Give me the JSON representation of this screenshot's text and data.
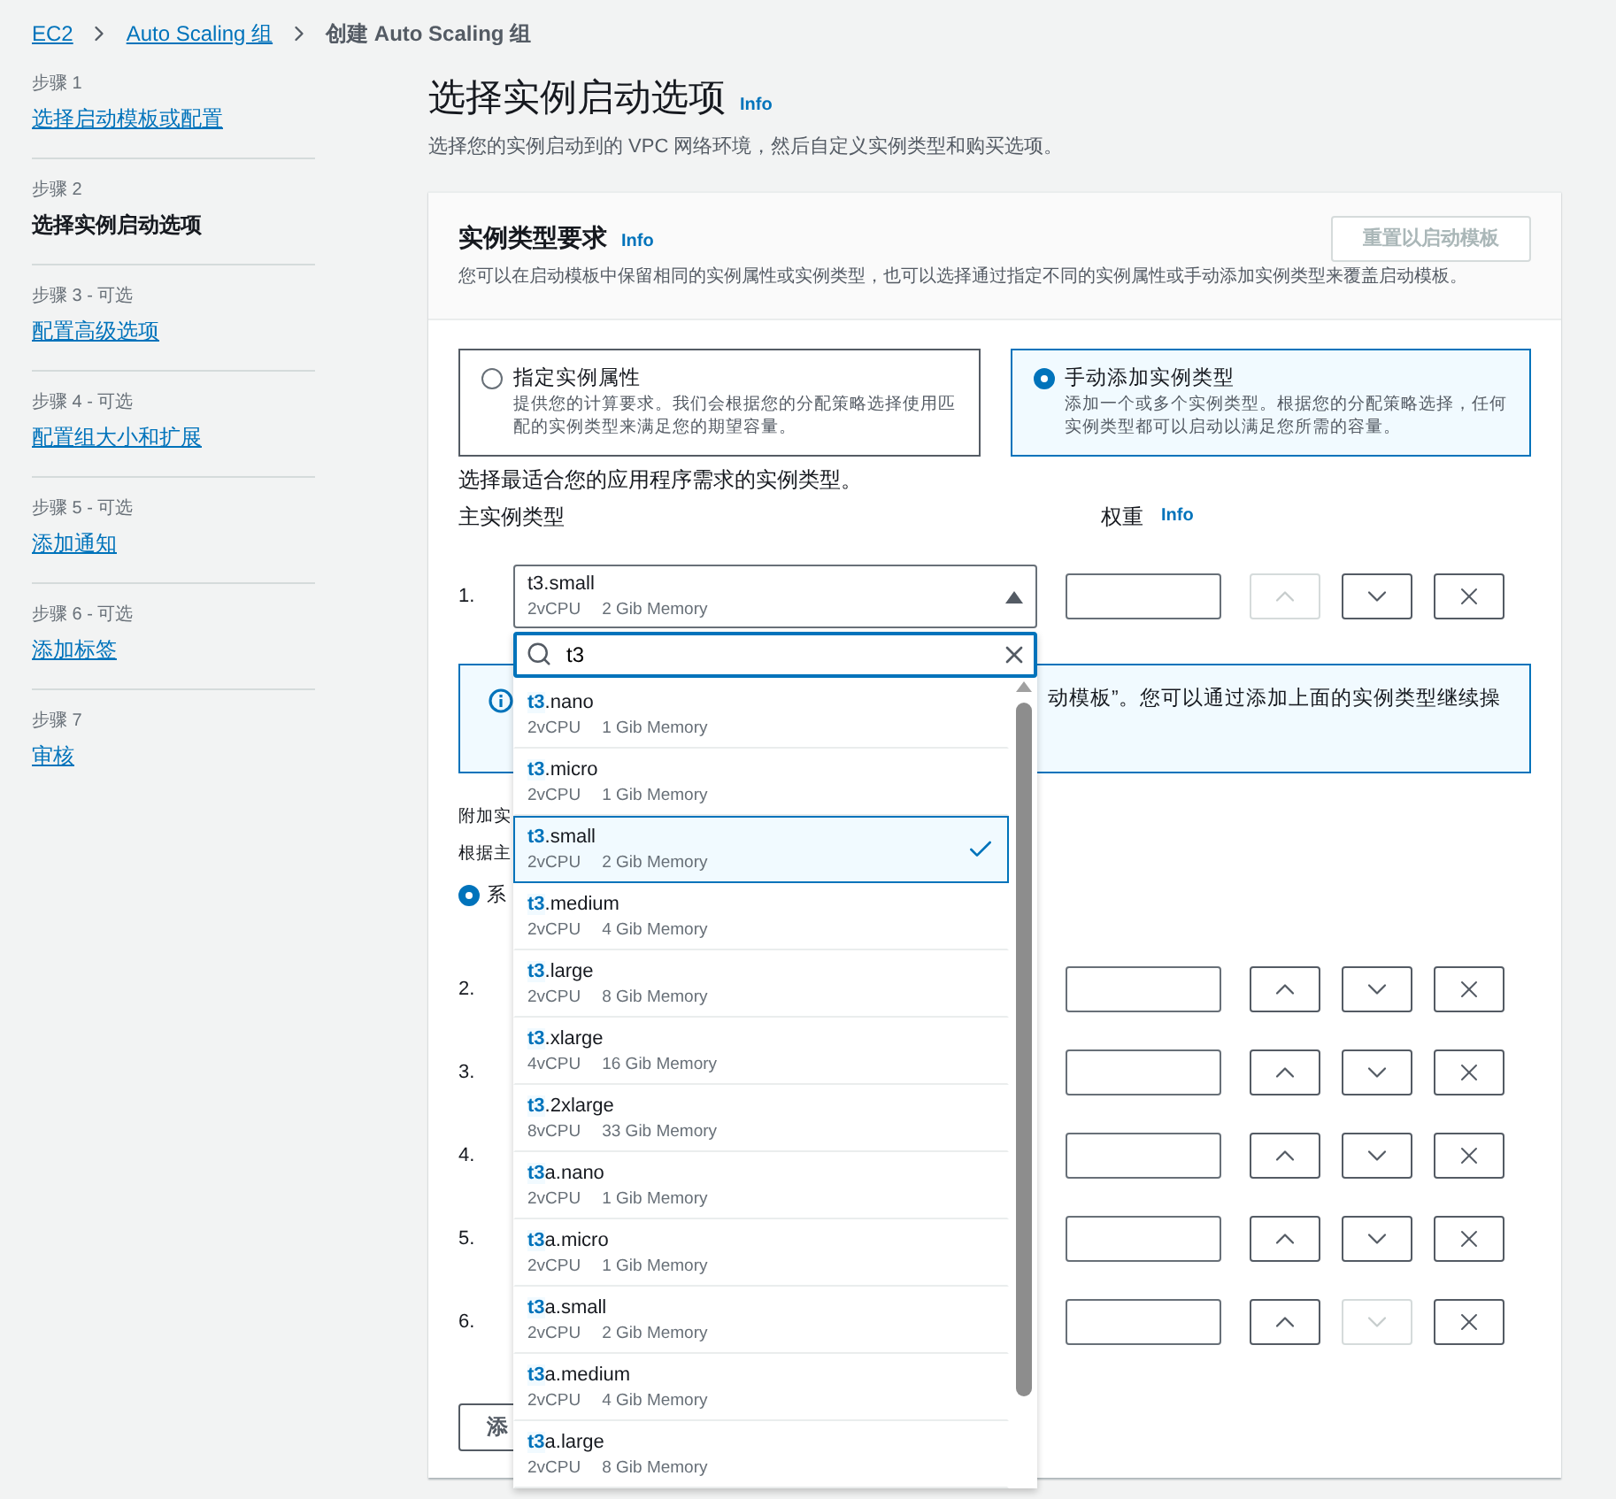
{
  "breadcrumb": [
    {
      "label": "EC2",
      "kind": "link"
    },
    {
      "label": "Auto Scaling 组",
      "kind": "link"
    },
    {
      "label": "创建 Auto Scaling 组",
      "kind": "current"
    }
  ],
  "steps": [
    {
      "label": "步骤 1",
      "title": "选择启动模板或配置",
      "selected": false
    },
    {
      "label": "步骤 2",
      "title": "选择实例启动选项",
      "selected": true
    },
    {
      "label": "步骤 3 - 可选",
      "title": "配置高级选项",
      "selected": false
    },
    {
      "label": "步骤 4 - 可选",
      "title": "配置组大小和扩展",
      "selected": false
    },
    {
      "label": "步骤 5 - 可选",
      "title": "添加通知",
      "selected": false
    },
    {
      "label": "步骤 6 - 可选",
      "title": "添加标签",
      "selected": false
    },
    {
      "label": "步骤 7",
      "title": "审核",
      "selected": false
    }
  ],
  "page": {
    "title": "选择实例启动选项",
    "info": "Info",
    "subtitle": "选择您的实例启动到的 VPC 网络环境，然后自定义实例类型和购买选项。"
  },
  "panel": {
    "title": "实例类型要求",
    "info": "Info",
    "description": "您可以在启动模板中保留相同的实例属性或实例类型，也可以选择通过指定不同的实例属性或手动添加实例类型来覆盖启动模板。",
    "reset_button": {
      "label": "重置以启动模板",
      "disabled": true
    }
  },
  "options": [
    {
      "title": "指定实例属性",
      "description": "提供您的计算要求。我们会根据您的分配策略选择使用匹配的实例类型来满足您的期望容量。",
      "selected": false
    },
    {
      "title": "手动添加实例类型",
      "description": "添加一个或多个实例类型。根据您的分配策略选择，任何实例类型都可以启动以满足您所需的容量。",
      "selected": true
    }
  ],
  "hint": "选择最适合您的应用程序需求的实例类型。",
  "primary_label": "主实例类型",
  "weight_label": "权重",
  "weight_info": "Info",
  "primary_select": {
    "value": "t3.small",
    "cpu": "2vCPU",
    "memory": "2 Gib Memory",
    "expanded": true
  },
  "dropdown": {
    "search": "t3",
    "items": [
      {
        "match": "t3",
        "rest": ".nano",
        "cpu": "2vCPU",
        "memory": "1 Gib Memory",
        "selected": false
      },
      {
        "match": "t3",
        "rest": ".micro",
        "cpu": "2vCPU",
        "memory": "1 Gib Memory",
        "selected": false
      },
      {
        "match": "t3",
        "rest": ".small",
        "cpu": "2vCPU",
        "memory": "2 Gib Memory",
        "selected": true
      },
      {
        "match": "t3",
        "rest": ".medium",
        "cpu": "2vCPU",
        "memory": "4 Gib Memory",
        "selected": false
      },
      {
        "match": "t3",
        "rest": ".large",
        "cpu": "2vCPU",
        "memory": "8 Gib Memory",
        "selected": false
      },
      {
        "match": "t3",
        "rest": ".xlarge",
        "cpu": "4vCPU",
        "memory": "16 Gib Memory",
        "selected": false
      },
      {
        "match": "t3",
        "rest": ".2xlarge",
        "cpu": "8vCPU",
        "memory": "33 Gib Memory",
        "selected": false
      },
      {
        "match": "t3",
        "rest": "a.nano",
        "cpu": "2vCPU",
        "memory": "1 Gib Memory",
        "selected": false
      },
      {
        "match": "t3",
        "rest": "a.micro",
        "cpu": "2vCPU",
        "memory": "1 Gib Memory",
        "selected": false
      },
      {
        "match": "t3",
        "rest": "a.small",
        "cpu": "2vCPU",
        "memory": "2 Gib Memory",
        "selected": false
      },
      {
        "match": "t3",
        "rest": "a.medium",
        "cpu": "2vCPU",
        "memory": "4 Gib Memory",
        "selected": false
      },
      {
        "match": "t3",
        "rest": "a.large",
        "cpu": "2vCPU",
        "memory": "8 Gib Memory",
        "selected": false
      }
    ]
  },
  "info_message": "动模板”。您可以通过添加上面的实例类型继续操",
  "additional": {
    "heading": "附加实",
    "text": "根据主",
    "radio": {
      "label": "系",
      "selected": true
    }
  },
  "rows": [
    {
      "number": "1.",
      "up_disabled": true,
      "down_disabled": false
    },
    {
      "number": "2.",
      "up_disabled": false,
      "down_disabled": false
    },
    {
      "number": "3.",
      "up_disabled": false,
      "down_disabled": false
    },
    {
      "number": "4.",
      "up_disabled": false,
      "down_disabled": false
    },
    {
      "number": "5.",
      "up_disabled": false,
      "down_disabled": false
    },
    {
      "number": "6.",
      "up_disabled": false,
      "down_disabled": true
    }
  ],
  "add_button": "添"
}
